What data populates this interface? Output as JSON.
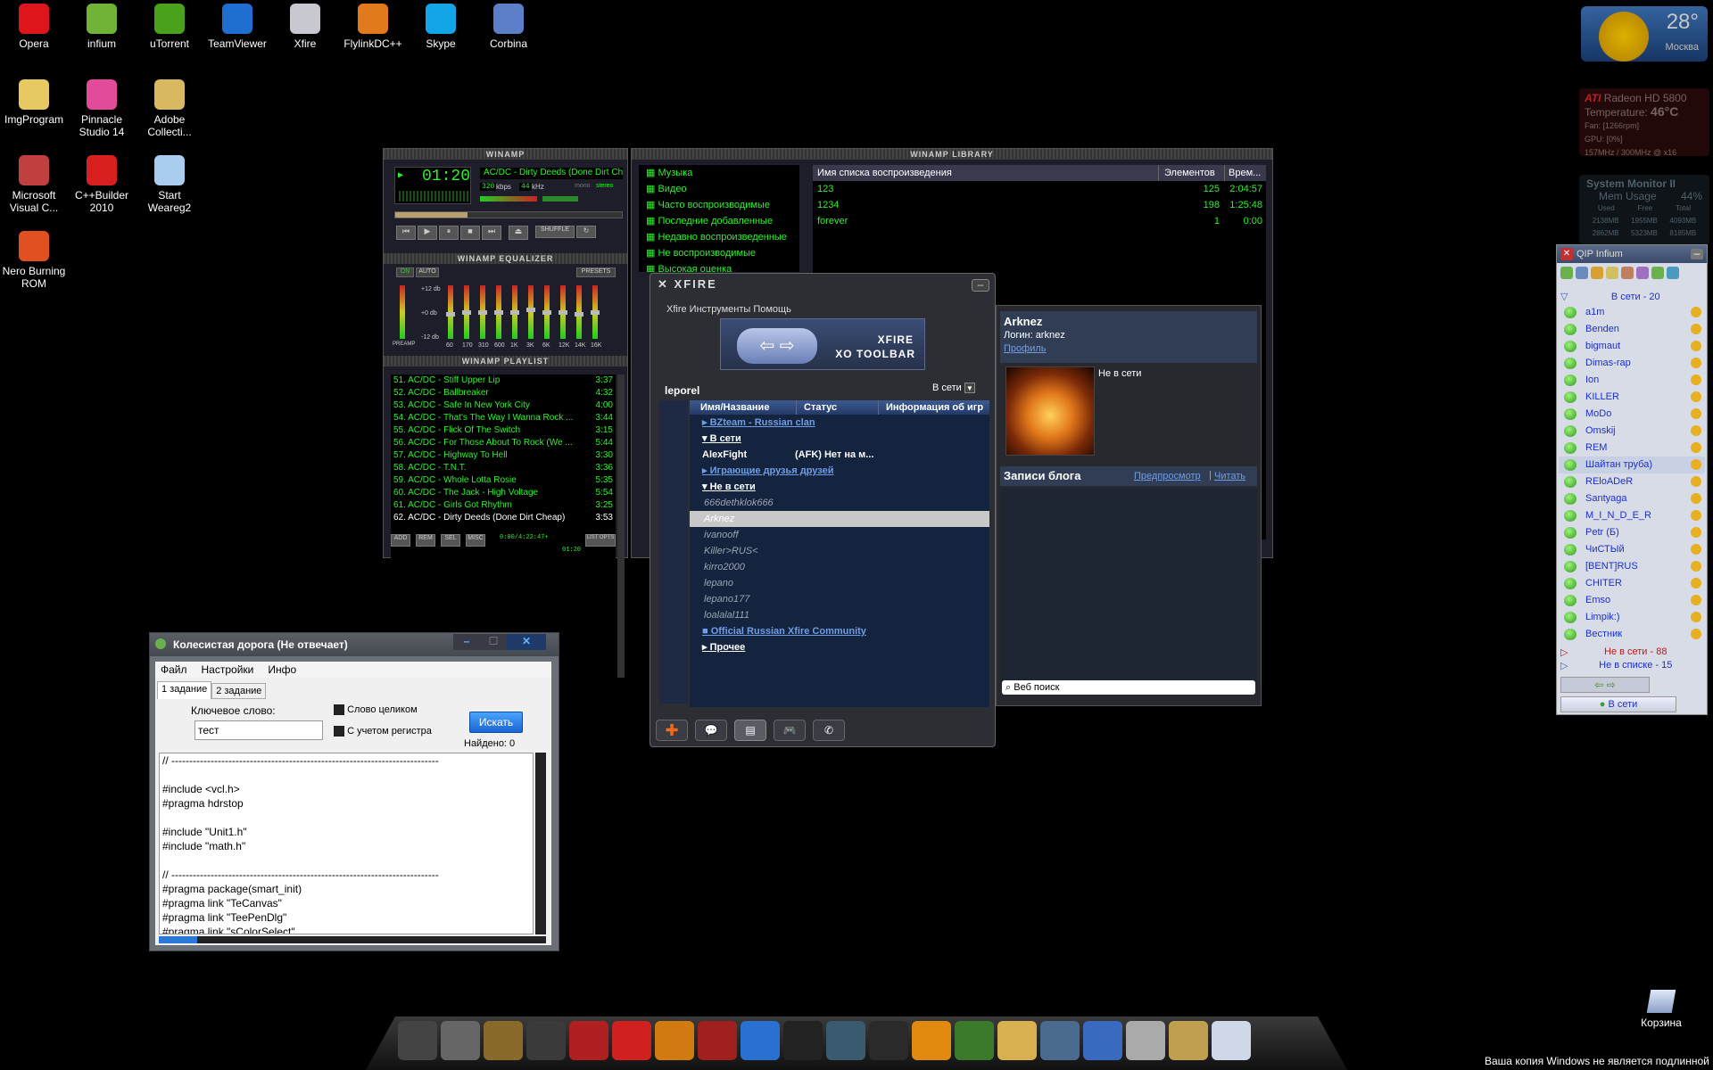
{
  "desktop_icons": [
    {
      "label": "Opera",
      "icon": "opera-icon",
      "color": "#e0151b"
    },
    {
      "label": "infium",
      "icon": "infium-icon",
      "color": "#6fb436"
    },
    {
      "label": "uTorrent",
      "icon": "utorrent-icon",
      "color": "#4aa11b"
    },
    {
      "label": "TeamViewer",
      "icon": "teamviewer-icon",
      "color": "#1f6fd0"
    },
    {
      "label": "Xfire",
      "icon": "xfire-icon",
      "color": "#c8c8d0"
    },
    {
      "label": "FlylinkDC++",
      "icon": "flylink-icon",
      "color": "#e07a1a"
    },
    {
      "label": "Skype",
      "icon": "skype-icon",
      "color": "#12a5e8"
    },
    {
      "label": "Corbina",
      "icon": "corbina-icon",
      "color": "#5b7fc8"
    },
    {
      "label": "ImgProgram",
      "icon": "folder-icon",
      "color": "#e8c860"
    },
    {
      "label": "Pinnacle Studio 14",
      "icon": "pinnacle-icon",
      "color": "#e24a9a"
    },
    {
      "label": "Adobe Collecti...",
      "icon": "folder-icon",
      "color": "#d8b860"
    },
    {
      "label": "Microsoft Visual C...",
      "icon": "visual-studio-icon",
      "color": "#c04040"
    },
    {
      "label": "C++Builder 2010",
      "icon": "cppbuilder-icon",
      "color": "#d82020"
    },
    {
      "label": "Start Weareg2",
      "icon": "start-icon",
      "color": "#aaccee"
    },
    {
      "label": "Nero Burning ROM",
      "icon": "nero-icon",
      "color": "#e05020"
    }
  ],
  "gadgets": {
    "weather": {
      "temp": "28°",
      "city": "Москва"
    },
    "gpu": {
      "brand": "ATI",
      "model": "Radeon HD 5800",
      "temp_label": "Temperature:",
      "temp": "46°C",
      "fan": "Fan: [1266rpm]",
      "gpu_load": "GPU: [0%]",
      "clocks": "157MHz / 300MHz @ x16"
    },
    "sysmon": {
      "title": "System Monitor II",
      "mem_label": "Mem Usage",
      "mem_pct": "44%",
      "cols": [
        "Used",
        "Free",
        "Total"
      ],
      "row1": [
        "2138MB",
        "1955MB",
        "4093MB"
      ],
      "row2": [
        "2862MB",
        "5323MB",
        "8185MB"
      ]
    }
  },
  "winamp": {
    "title": "WINAMP",
    "time": "01:20",
    "track": "AC/DC - Dirty Deeds (Done Dirt Cheap)",
    "kbps": "320",
    "khz": "44",
    "kbps_label": "kbps",
    "khz_label": "kHz",
    "mono": "mono",
    "stereo": "stereo",
    "shuffle": "SHUFFLE",
    "eq_title": "WINAMP EQUALIZER",
    "eq_on": "ON",
    "eq_auto": "AUTO",
    "eq_presets": "PRESETS",
    "eq_db_top": "+12 db",
    "eq_db_mid": "+0 db",
    "eq_db_bot": "-12 db",
    "eq_preamp": "PREAMP",
    "eq_bands": [
      "60",
      "170",
      "310",
      "600",
      "1K",
      "3K",
      "6K",
      "12K",
      "14K",
      "16K"
    ],
    "eq_levels": [
      0.55,
      0.5,
      0.5,
      0.5,
      0.5,
      0.45,
      0.5,
      0.5,
      0.55,
      0.5
    ],
    "pl_title": "WINAMP PLAYLIST",
    "playlist": [
      {
        "t": "51. AC/DC - Stiff Upper Lip",
        "d": "3:37"
      },
      {
        "t": "52. AC/DC - Ballbreaker",
        "d": "4:32"
      },
      {
        "t": "53. AC/DC - Safe In New York City",
        "d": "4:00"
      },
      {
        "t": "54. AC/DC - That's The Way I Wanna Rock ...",
        "d": "3:44"
      },
      {
        "t": "55. AC/DC - Flick Of The Switch",
        "d": "3:15"
      },
      {
        "t": "56. AC/DC - For Those About To Rock (We ...",
        "d": "5:44"
      },
      {
        "t": "57. AC/DC - Highway To Hell",
        "d": "3:30"
      },
      {
        "t": "58. AC/DC - T.N.T.",
        "d": "3:36"
      },
      {
        "t": "59. AC/DC - Whole Lotta Rosie",
        "d": "5:35"
      },
      {
        "t": "60. AC/DC - The Jack - High Voltage",
        "d": "5:54"
      },
      {
        "t": "61. AC/DC - Girls Got Rhythm",
        "d": "3:25"
      },
      {
        "t": "62. AC/DC - Dirty Deeds (Done Dirt Cheap)",
        "d": "3:53"
      }
    ],
    "pl_buttons": [
      "ADD",
      "REM",
      "SEL",
      "MISC"
    ],
    "pl_time": "0:00/4:22:47+",
    "pl_cur": "01:20",
    "pl_list": "LIST OPTS"
  },
  "library": {
    "title": "WINAMP LIBRARY",
    "tree": [
      "Музыка",
      "Видео",
      "Часто воспроизводимые",
      "Последние добавленные",
      "Недавно воспроизведенные",
      "Не воспроизводимые",
      "Высокая оценка"
    ],
    "columns": [
      "Имя списка воспроизведения",
      "Элементов",
      "Врем..."
    ],
    "rows": [
      {
        "name": "123",
        "count": "125",
        "time": "2:04:57"
      },
      {
        "name": "1234",
        "count": "198",
        "time": "1:25:48"
      },
      {
        "name": "forever",
        "count": "1",
        "time": "0:00"
      }
    ]
  },
  "xfire": {
    "brand": "XFIRE",
    "menu": "Xfire  Инструменты  Помощь",
    "banner_line1": "XFIRE",
    "banner_line2": "XO TOOLBAR",
    "user": "leporel",
    "status": "В сети",
    "columns": [
      "Имя/Название",
      "Статус",
      "Информация об игр"
    ],
    "groups": [
      {
        "kind": "group",
        "label": "BZteam - Russian clan"
      },
      {
        "kind": "header",
        "label": "В сети"
      },
      {
        "kind": "friend-online",
        "label": "AlexFight",
        "status": "(AFK) Нет на м..."
      },
      {
        "kind": "group",
        "label": "Играющие друзья друзей"
      },
      {
        "kind": "header",
        "label": "Не в сети"
      },
      {
        "kind": "friend",
        "label": "666dethklok666"
      },
      {
        "kind": "friend-selected",
        "label": "Arknez"
      },
      {
        "kind": "friend",
        "label": "ivanooff"
      },
      {
        "kind": "friend",
        "label": "Killer>RUS<"
      },
      {
        "kind": "friend",
        "label": "kirro2000"
      },
      {
        "kind": "friend",
        "label": "lepano"
      },
      {
        "kind": "friend",
        "label": "lepano177"
      },
      {
        "kind": "friend",
        "label": "loalalal111"
      },
      {
        "kind": "community",
        "label": "Official Russian Xfire Community"
      },
      {
        "kind": "header2",
        "label": "Прочее"
      }
    ],
    "profile": {
      "name": "Arknez",
      "login_label": "Логин:",
      "login": "arknez",
      "profile_link": "Профиль",
      "online_state": "Не в сети",
      "blog_title": "Записи блога",
      "blog_preview": "Предпросмотр",
      "blog_read": "Читать",
      "search_placeholder": "Веб поиск"
    }
  },
  "qip": {
    "title": "QIP Infium",
    "online_group": "В сети - 20",
    "contacts": [
      "a1m",
      "Benden",
      "bigmaut",
      "Dimas-rap",
      "Ion",
      "KILLER",
      "MoDo",
      "Omskij",
      "REM",
      "Шайтан труба)",
      "REloADeR",
      "Santyaga",
      "M_I_N_D_E_R",
      "Petr (Б)",
      "ЧиСТЫй",
      "[BENT]RUS",
      "CHITER",
      "Emso",
      "Limpik:)",
      "Вестник"
    ],
    "offline_group": "Не в сети - 88",
    "notlist_group": "Не в списке - 15",
    "status_button": "В сети"
  },
  "app": {
    "title": "Колесистая дорога (Не отвечает)",
    "menu": [
      "Файл",
      "Настройки",
      "Инфо"
    ],
    "tabs": [
      "1 задание",
      "2 задание"
    ],
    "keyword_label": "Ключевое слово:",
    "keyword_value": "тест",
    "whole_word": "Слово целиком",
    "match_case": "С учетом регистра",
    "search_button": "Искать",
    "found": "Найдено: 0",
    "code": [
      "// ---------------------------------------------------------------------------",
      "",
      "#include <vcl.h>",
      "#pragma hdrstop",
      "",
      "#include \"Unit1.h\"",
      "#include \"math.h\"",
      "",
      "// ---------------------------------------------------------------------------",
      "#pragma package(smart_init)",
      "#pragma link \"TeCanvas\"",
      "#pragma link \"TeePenDlg\"",
      "#pragma link \"sColorSelect\""
    ]
  },
  "recycle": "Корзина",
  "watermark": "Ваша копия Windows не является подлинной",
  "taskbar_icons": [
    "steam-icon",
    "game-icon",
    "just-cause-icon",
    "game2-icon",
    "gears-icon",
    "l4d2-icon",
    "half-life-icon",
    "metro-icon",
    "l4d-2-icon",
    "rockstar-icon",
    "game3-icon",
    "warcraft-icon",
    "sprint-icon",
    "flower-icon",
    "folder-icon",
    "game4-icon",
    "game5-icon",
    "tools-icon",
    "tools2-icon",
    "recycle-icon"
  ]
}
